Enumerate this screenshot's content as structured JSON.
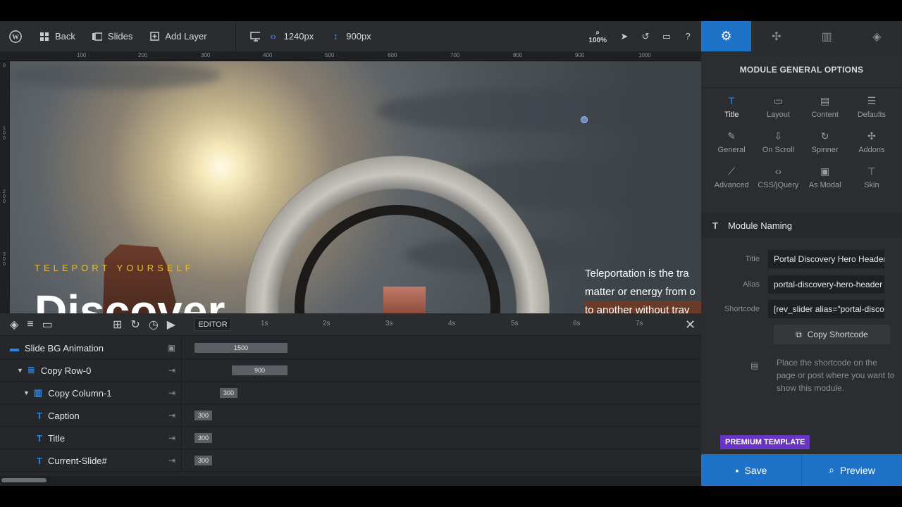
{
  "toolbar": {
    "back_label": "Back",
    "slides_label": "Slides",
    "add_layer_label": "Add Layer",
    "width_value": "1240px",
    "height_value": "900px",
    "zoom_value": "100%"
  },
  "ruler": {
    "h_marks": [
      "100",
      "200",
      "300",
      "400",
      "500",
      "600",
      "700",
      "800",
      "900",
      "1000"
    ],
    "v_marks": [
      "0",
      "1 0 0",
      "2 0 0",
      "3 0 0"
    ]
  },
  "canvas": {
    "subtitle": "TELEPORT YOURSELF",
    "title": "Discover",
    "paragraph_lines": [
      "Teleportation is the tra",
      "matter or energy from o",
      "to another without trav"
    ]
  },
  "timeline": {
    "editor_tab": "EDITOR",
    "ticks": [
      "1s",
      "2s",
      "3s",
      "4s",
      "5s",
      "6s",
      "7s"
    ],
    "rows": [
      {
        "label": "Slide BG Animation",
        "bar": "1500"
      },
      {
        "label": "Copy Row-0",
        "bar": "900"
      },
      {
        "label": "Copy Column-1",
        "bar": "300"
      },
      {
        "label": "Caption",
        "bar": "300"
      },
      {
        "label": "Title",
        "bar": "300"
      },
      {
        "label": "Current-Slide#",
        "bar": "300"
      }
    ]
  },
  "panel": {
    "title": "MODULE GENERAL OPTIONS",
    "options": [
      "Title",
      "Layout",
      "Content",
      "Defaults",
      "General",
      "On Scroll",
      "Spinner",
      "Addons",
      "Advanced",
      "CSS/jQuery",
      "As Modal",
      "Skin"
    ],
    "naming_head": "Module Naming",
    "fields": {
      "title_label": "Title",
      "title_value": "Portal Discovery Hero Header",
      "alias_label": "Alias",
      "alias_value": "portal-discovery-hero-header",
      "shortcode_label": "Shortcode",
      "shortcode_value": "[rev_slider alias=\"portal-discovery-hero-header\"]"
    },
    "copy_shortcode": "Copy Shortcode",
    "hint": "Place the shortcode on the page or post where you want to show this module.",
    "premium": "PREMIUM TEMPLATE"
  },
  "actions": {
    "save": "Save",
    "preview": "Preview"
  },
  "colors": {
    "accent": "#1e73c8",
    "premium": "#6a35c4",
    "subtitle": "#e5b93b"
  }
}
